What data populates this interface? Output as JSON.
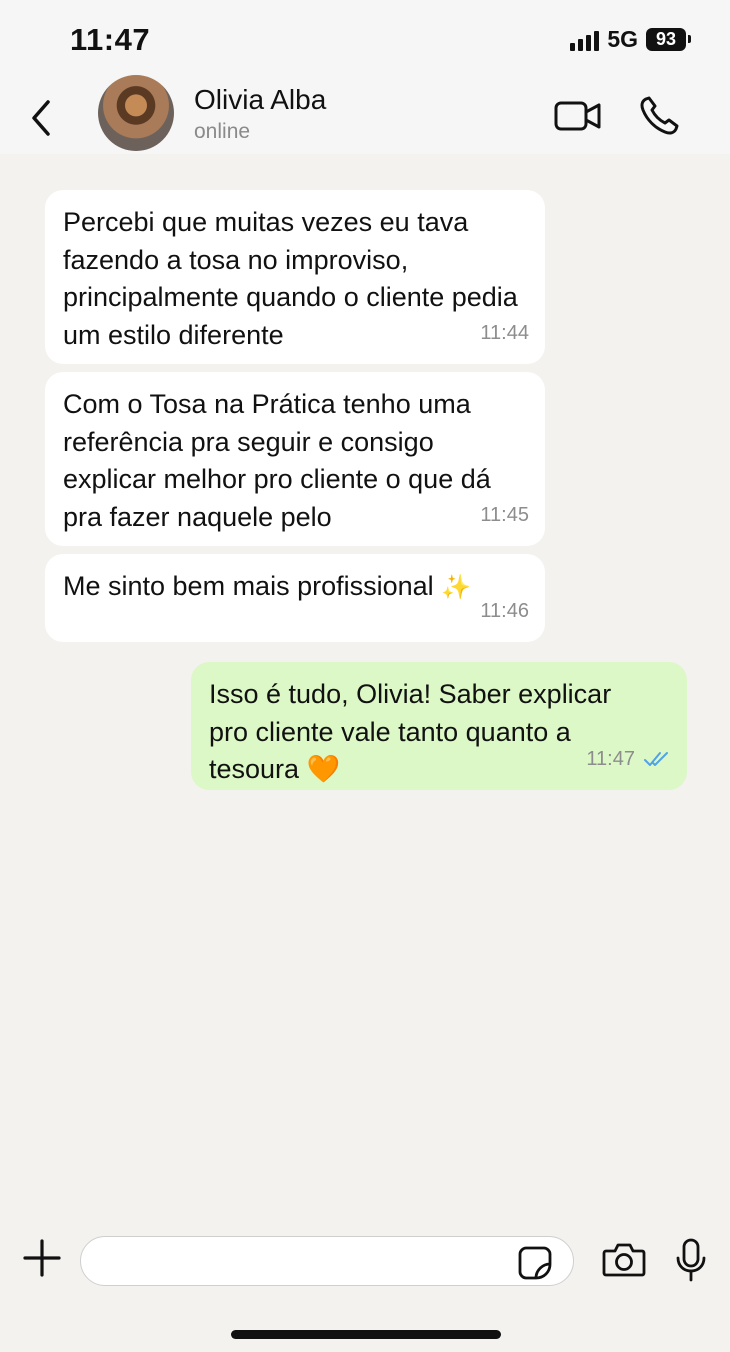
{
  "status_bar": {
    "time": "11:47",
    "network": "5G",
    "battery": "93"
  },
  "header": {
    "contact_name": "Olivia Alba",
    "contact_status": "online"
  },
  "messages": [
    {
      "direction": "in",
      "text": "Percebi que muitas vezes eu tava fazendo a tosa no improviso, principalmente quando o cliente pedia um estilo diferente",
      "time": "11:44"
    },
    {
      "direction": "in",
      "text": "Com o Tosa na Prática tenho uma referência pra seguir e consigo explicar melhor pro cliente o que dá pra fazer naquele pelo",
      "time": "11:45"
    },
    {
      "direction": "in",
      "text": "Me sinto bem mais profissional",
      "emoji": "✨",
      "time": "11:46"
    },
    {
      "direction": "out",
      "text": "Isso é tudo, Olivia! Saber explicar pro cliente vale tanto quanto a tesoura",
      "emoji": "🧡",
      "time": "11:47",
      "read_receipt": "double-check-icon"
    }
  ],
  "input_bar": {
    "placeholder": "",
    "value": ""
  },
  "colors": {
    "incoming_bubble": "#ffffff",
    "outgoing_bubble": "#dcf8c6",
    "read_check": "#4fa3e8",
    "background": "#f3f2ef"
  }
}
